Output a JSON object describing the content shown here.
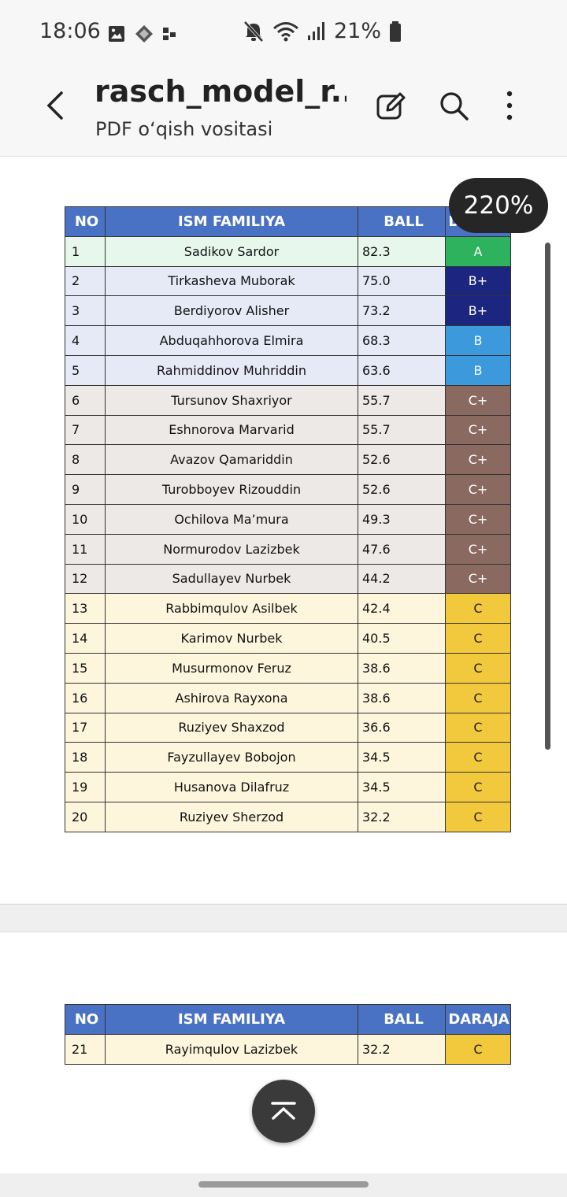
{
  "status_bar": {
    "time": "18:06",
    "battery": "21%",
    "icons": [
      "gallery-icon",
      "app-icon",
      "dots-icon",
      "mute-icon",
      "wifi-icon",
      "signal-icon",
      "battery-icon"
    ]
  },
  "app_bar": {
    "title": "rasch_model_r...",
    "subtitle": "PDF o‘qish vositasi",
    "icons": [
      "back-arrow-icon",
      "edit-icon",
      "search-icon",
      "more-vert-icon"
    ]
  },
  "zoom": "220%",
  "table_headers": {
    "no": "NO",
    "name": "ISM FAMILIYA",
    "ball": "BALL",
    "grade": "DARAJA"
  },
  "grade_colors": {
    "A": {
      "bg": "#2db35d",
      "fg": "#ffffff",
      "row": "#e8f7ec"
    },
    "B+": {
      "bg": "#1c2580",
      "fg": "#ffffff",
      "row": "#e6e9f6"
    },
    "B": {
      "bg": "#3c99dc",
      "fg": "#ffffff",
      "row": "#e6e9f6"
    },
    "C+": {
      "bg": "#8a6a60",
      "fg": "#ffffff",
      "row": "#ede9e6"
    },
    "C": {
      "bg": "#f2c93c",
      "fg": "#222222",
      "row": "#fdf6dd"
    }
  },
  "page1_rows": [
    {
      "no": "1",
      "name": "Sadikov Sardor",
      "ball": "82.3",
      "grade": "A"
    },
    {
      "no": "2",
      "name": "Tirkasheva Muborak",
      "ball": "75.0",
      "grade": "B+"
    },
    {
      "no": "3",
      "name": "Berdiyorov Alisher",
      "ball": "73.2",
      "grade": "B+"
    },
    {
      "no": "4",
      "name": "Abduqahhorova Elmira",
      "ball": "68.3",
      "grade": "B"
    },
    {
      "no": "5",
      "name": "Rahmiddinov Muhriddin",
      "ball": "63.6",
      "grade": "B"
    },
    {
      "no": "6",
      "name": "Tursunov Shaxriyor",
      "ball": "55.7",
      "grade": "C+"
    },
    {
      "no": "7",
      "name": "Eshnorova Marvarid",
      "ball": "55.7",
      "grade": "C+"
    },
    {
      "no": "8",
      "name": "Avazov Qamariddin",
      "ball": "52.6",
      "grade": "C+"
    },
    {
      "no": "9",
      "name": "Turobboyev Rizouddin",
      "ball": "52.6",
      "grade": "C+"
    },
    {
      "no": "10",
      "name": "Ochilova Ma’mura",
      "ball": "49.3",
      "grade": "C+"
    },
    {
      "no": "11",
      "name": "Normurodov Lazizbek",
      "ball": "47.6",
      "grade": "C+"
    },
    {
      "no": "12",
      "name": "Sadullayev Nurbek",
      "ball": "44.2",
      "grade": "C+"
    },
    {
      "no": "13",
      "name": "Rabbimqulov Asilbek",
      "ball": "42.4",
      "grade": "C"
    },
    {
      "no": "14",
      "name": "Karimov Nurbek",
      "ball": "40.5",
      "grade": "C"
    },
    {
      "no": "15",
      "name": "Musurmonov Feruz",
      "ball": "38.6",
      "grade": "C"
    },
    {
      "no": "16",
      "name": "Ashirova Rayxona",
      "ball": "38.6",
      "grade": "C"
    },
    {
      "no": "17",
      "name": "Ruziyev Shaxzod",
      "ball": "36.6",
      "grade": "C"
    },
    {
      "no": "18",
      "name": "Fayzullayev Bobojon",
      "ball": "34.5",
      "grade": "C"
    },
    {
      "no": "19",
      "name": "Husanova Dilafruz",
      "ball": "34.5",
      "grade": "C"
    },
    {
      "no": "20",
      "name": "Ruziyev Sherzod",
      "ball": "32.2",
      "grade": "C"
    }
  ],
  "page2_rows": [
    {
      "no": "21",
      "name": "Rayimqulov Lazizbek",
      "ball": "32.2",
      "grade": "C"
    }
  ]
}
